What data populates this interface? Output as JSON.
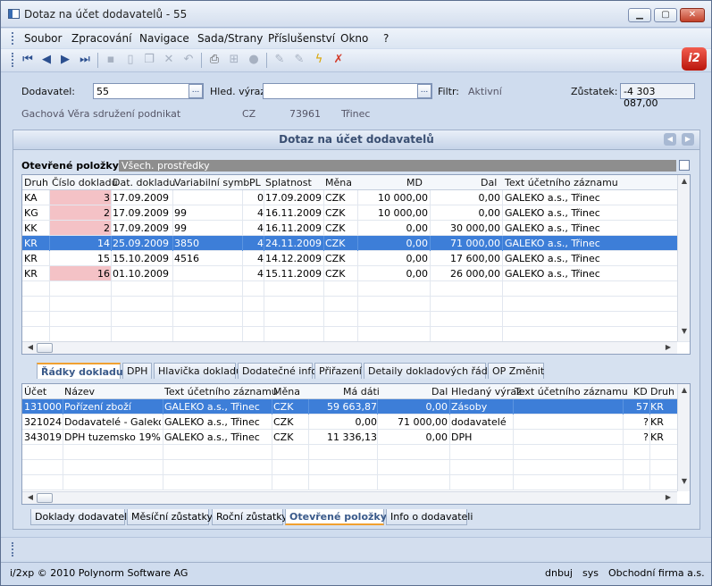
{
  "window": {
    "title": "Dotaz na účet dodavatelů - 55"
  },
  "menu": [
    "Soubor",
    "Zpracování",
    "Navigace",
    "Sada/Strany",
    "Příslušenství",
    "Okno",
    "?"
  ],
  "header": {
    "dodavatel_label": "Dodavatel:",
    "dodavatel_value": "55",
    "hled_label": "Hled. výraz:",
    "hled_value": "",
    "filtr_label": "Filtr:",
    "filtr_value": "Aktivní",
    "zustatek_label": "Zůstatek:",
    "zustatek_value": "-4 303 087,00",
    "supplier_name": "Gachová Věra sdružení podnikat",
    "country": "CZ",
    "zip": "73961",
    "city": "Třinec",
    "ellipsis": "..."
  },
  "panel": {
    "title": "Dotaz na účet dodavatelů",
    "open_items_label": "Otevřené položky",
    "open_items_filter": "Všech. prostředky"
  },
  "top_grid": {
    "columns": [
      "Druh",
      "Číslo dokladu",
      "Dat. dokladu",
      "Variabilní symb.",
      "PL",
      "Splatnost",
      "Měna",
      "MD",
      "Dal",
      "Text účetního záznamu"
    ],
    "rows": [
      {
        "druh": "KA",
        "cislo": "3",
        "datum": "17.09.2009",
        "vs": "",
        "pl": "0",
        "splatnost": "17.09.2009",
        "mena": "CZK",
        "md": "10 000,00",
        "dal": "0,00",
        "text": "GALEKO a.s., Třinec",
        "pink": true,
        "sel": false
      },
      {
        "druh": "KG",
        "cislo": "2",
        "datum": "17.09.2009",
        "vs": "99",
        "pl": "4",
        "splatnost": "16.11.2009",
        "mena": "CZK",
        "md": "10 000,00",
        "dal": "0,00",
        "text": "GALEKO a.s., Třinec",
        "pink": true,
        "sel": false
      },
      {
        "druh": "KK",
        "cislo": "2",
        "datum": "17.09.2009",
        "vs": "99",
        "pl": "4",
        "splatnost": "16.11.2009",
        "mena": "CZK",
        "md": "0,00",
        "dal": "30 000,00",
        "text": "GALEKO a.s., Třinec",
        "pink": true,
        "sel": false
      },
      {
        "druh": "KR",
        "cislo": "14",
        "datum": "25.09.2009",
        "vs": "3850",
        "pl": "4",
        "splatnost": "24.11.2009",
        "mena": "CZK",
        "md": "0,00",
        "dal": "71 000,00",
        "text": "GALEKO a.s., Třinec",
        "pink": true,
        "sel": true
      },
      {
        "druh": "KR",
        "cislo": "15",
        "datum": "15.10.2009",
        "vs": "4516",
        "pl": "4",
        "splatnost": "14.12.2009",
        "mena": "CZK",
        "md": "0,00",
        "dal": "17 600,00",
        "text": "GALEKO a.s., Třinec",
        "pink": false,
        "sel": false
      },
      {
        "druh": "KR",
        "cislo": "16",
        "datum": "01.10.2009",
        "vs": "",
        "pl": "4",
        "splatnost": "15.11.2009",
        "mena": "CZK",
        "md": "0,00",
        "dal": "26 000,00",
        "text": "GALEKO a.s., Třinec",
        "pink": true,
        "sel": false
      }
    ]
  },
  "detail_tabs": [
    "Řádky dokladu",
    "DPH",
    "Hlavička dokladu",
    "Dodatečné info",
    "Přiřazení",
    "Detaily dokladových řádků",
    "OP Změnit"
  ],
  "bottom_grid": {
    "columns": [
      "Účet",
      "Název",
      "Text účetního záznamu",
      "Měna",
      "Má dáti",
      "Dal",
      "Hledaný výraz",
      "Text účetního záznamu",
      "KD",
      "Druh"
    ],
    "rows": [
      {
        "ucet": "131000",
        "nazev": "Pořízení zboží",
        "text": "GALEKO a.s., Třinec",
        "mena": "CZK",
        "madati": "59 663,87",
        "dal": "0,00",
        "hledany": "Zásoby",
        "text2": "",
        "kd": "57",
        "druh": "KR",
        "sel": true
      },
      {
        "ucet": "321024",
        "nazev": "Dodavatelé - Galeko",
        "text": "GALEKO a.s., Třinec",
        "mena": "CZK",
        "madati": "0,00",
        "dal": "71 000,00",
        "hledany": "dodavatelé",
        "text2": "",
        "kd": "?",
        "druh": "KR",
        "sel": false
      },
      {
        "ucet": "343019",
        "nazev": "DPH tuzemsko 19%",
        "text": "GALEKO a.s., Třinec",
        "mena": "CZK",
        "madati": "11 336,13",
        "dal": "0,00",
        "hledany": "DPH",
        "text2": "",
        "kd": "?",
        "druh": "KR",
        "sel": false
      }
    ]
  },
  "bottom_tabs": [
    "Doklady dodavatele",
    "Měsíční zůstatky",
    "Roční zůstatky",
    "Otevřené položky",
    "Info o dodavateli"
  ],
  "status": {
    "copyright": "i/2xp © 2010 Polynorm Software AG",
    "db": "dnbuj",
    "user": "sys",
    "company": "Obchodní firma a.s."
  },
  "logo_text": "i2"
}
